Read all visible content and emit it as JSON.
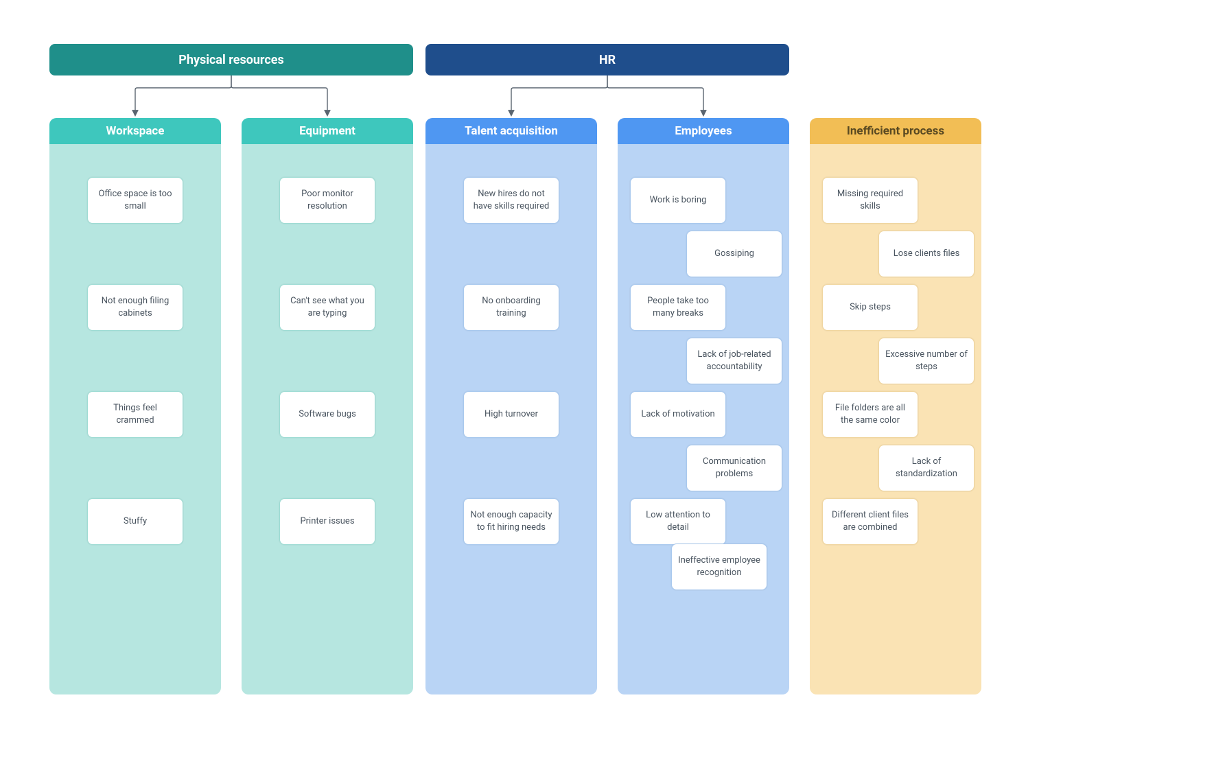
{
  "groups": {
    "physical": {
      "title": "Physical resources"
    },
    "hr": {
      "title": "HR"
    }
  },
  "columns": {
    "workspace": {
      "title": "Workspace",
      "cards": [
        "Office space is too small",
        "Not enough filing cabinets",
        "Things feel crammed",
        "Stuffy"
      ]
    },
    "equipment": {
      "title": "Equipment",
      "cards": [
        "Poor monitor resolution",
        "Can't see what you are typing",
        "Software bugs",
        "Printer issues"
      ]
    },
    "talent": {
      "title": "Talent acquisition",
      "cards": [
        "New hires do not have skills required",
        "No onboarding training",
        "High turnover",
        "Not enough capacity to fit hiring needs"
      ]
    },
    "employees": {
      "title": "Employees",
      "cards": [
        "Work is boring",
        "Gossiping",
        "People take too many breaks",
        "Lack of job-related accountability",
        "Lack of motivation",
        "Communication problems",
        "Low attention to detail",
        "Ineffective employee recognition"
      ]
    },
    "inefficient": {
      "title": "Inefficient process",
      "cards": [
        "Missing required skills",
        "Lose clients files",
        "Skip steps",
        "Excessive number of steps",
        "File folders are all the same color",
        "Lack of standardization",
        "Different client files are combined"
      ]
    }
  }
}
